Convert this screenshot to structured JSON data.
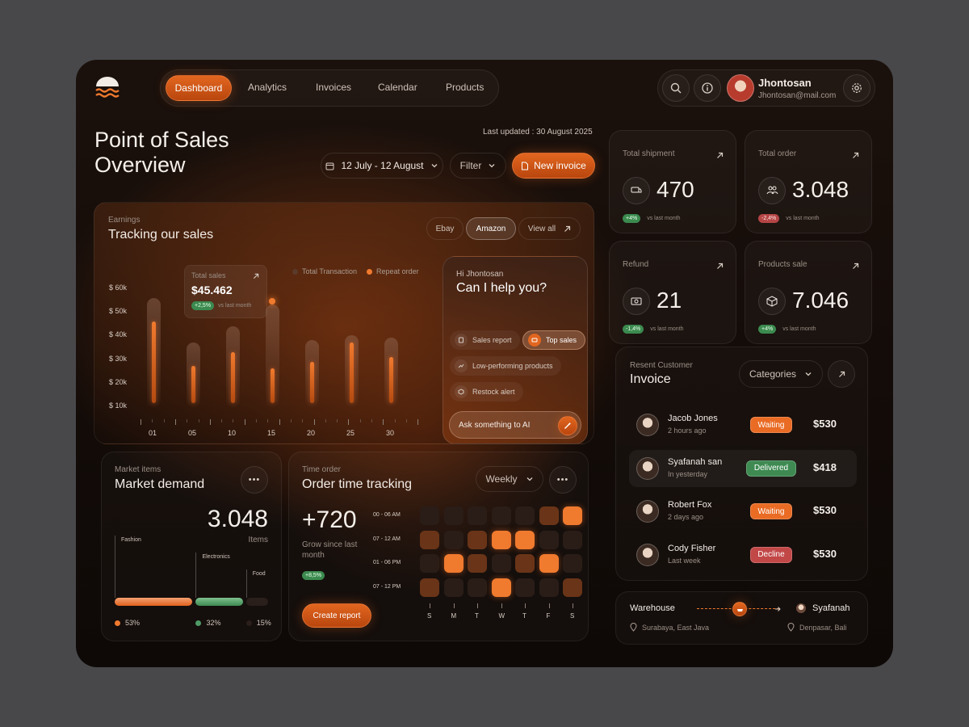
{
  "nav": {
    "tabs": [
      {
        "label": "Dashboard"
      },
      {
        "label": "Analytics"
      },
      {
        "label": "Invoices"
      },
      {
        "label": "Calendar"
      },
      {
        "label": "Products"
      }
    ]
  },
  "user": {
    "name": "Jhontosan",
    "email": "Jhontosan@mail.com"
  },
  "header": {
    "title_line1": "Point of Sales",
    "title_line2": "Overview",
    "last_updated": "Last updated : 30 August 2025",
    "date_range": "12 July - 12 August",
    "filter_label": "Filter",
    "new_invoice_label": "New invoice"
  },
  "earnings": {
    "eyebrow": "Earnings",
    "title": "Tracking our sales",
    "tabs": [
      {
        "label": "Ebay"
      },
      {
        "label": "Amazon"
      },
      {
        "label": "View all"
      }
    ],
    "total_sales_label": "Total sales",
    "total_sales_value": "$45.462",
    "total_sales_change": "+2,5%",
    "vs_last_month": "vs last month",
    "legend": [
      {
        "label": "Total Transaction",
        "color": "#5a3a2a"
      },
      {
        "label": "Repeat order",
        "color": "#f07a2e"
      }
    ]
  },
  "chart_data": {
    "type": "bar",
    "y_tick_labels": [
      "$ 60k",
      "$ 50k",
      "$ 40k",
      "$ 30k",
      "$ 20k",
      "$ 10k"
    ],
    "x_tick_labels": [
      "01",
      "05",
      "10",
      "15",
      "20",
      "25",
      "30"
    ],
    "ylim": [
      10,
      60
    ],
    "series": [
      {
        "name": "Total Transaction",
        "values": [
          56,
          37,
          44,
          53,
          38,
          40,
          39
        ]
      },
      {
        "name": "Repeat order",
        "values": [
          46,
          27,
          33,
          26,
          29,
          37,
          31
        ]
      }
    ],
    "highlight_index": 3,
    "grid": false,
    "legend_position": "top-right"
  },
  "ai": {
    "greeting": "Hi Jhontosan",
    "prompt": "Can I help you?",
    "chips": [
      {
        "label": "Sales report",
        "icon": "document-icon"
      },
      {
        "label": "Top sales",
        "icon": "receipt-icon"
      },
      {
        "label": "Low-performing products",
        "icon": "trend-icon"
      },
      {
        "label": "Restock alert",
        "icon": "box-icon"
      }
    ],
    "ask_placeholder": "Ask something to AI"
  },
  "market": {
    "eyebrow": "Market items",
    "title": "Market demand",
    "value": "3.048",
    "unit": "Items",
    "categories": [
      {
        "label": "Fashion",
        "percent": "53%",
        "share": 0.53,
        "color": "#f07a2e"
      },
      {
        "label": "Electronics",
        "percent": "32%",
        "share": 0.32,
        "color": "#4f9a66"
      },
      {
        "label": "Food",
        "percent": "15%",
        "share": 0.15,
        "color": "#2a1f1a"
      }
    ]
  },
  "order_time": {
    "eyebrow": "Time order",
    "title": "Order time tracking",
    "period": "Weekly",
    "value": "+720",
    "subtitle": "Grow since last month",
    "change": "+8,5%",
    "button_label": "Create report",
    "rows": [
      "00 - 06 AM",
      "07 - 12 AM",
      "01 - 06 PM",
      "07 - 12 PM"
    ],
    "days": [
      "S",
      "M",
      "T",
      "W",
      "T",
      "F",
      "S"
    ],
    "levels": [
      [
        1,
        1,
        1,
        1,
        1,
        2,
        3
      ],
      [
        2,
        1,
        2,
        3,
        3,
        1,
        1
      ],
      [
        1,
        3,
        2,
        1,
        2,
        3,
        1
      ],
      [
        2,
        1,
        1,
        3,
        1,
        1,
        2
      ]
    ]
  },
  "stats": [
    {
      "label": "Total shipment",
      "value": "470",
      "change": "+4%",
      "positive": true,
      "icon": "truck-icon"
    },
    {
      "label": "Total order",
      "value": "3.048",
      "change": "-2,4%",
      "positive": false,
      "icon": "users-icon"
    },
    {
      "label": "Refund",
      "value": "21",
      "change": "-1,4%",
      "positive": true,
      "icon": "money-icon"
    },
    {
      "label": "Products sale",
      "value": "7.046",
      "change": "+4%",
      "positive": true,
      "icon": "cube-icon"
    }
  ],
  "stats_vs": "vs last month",
  "invoice": {
    "eyebrow": "Resent Customer",
    "title": "Invoice",
    "filter_label": "Categories",
    "rows": [
      {
        "name": "Jacob Jones",
        "time": "2 hours ago",
        "status": "Waiting",
        "amount": "$530",
        "status_color": "#e96b24"
      },
      {
        "name": "Syafanah san",
        "time": "In yesterday",
        "status": "Delivered",
        "amount": "$418",
        "status_color": "#3e8a52"
      },
      {
        "name": "Robert Fox",
        "time": "2 days ago",
        "status": "Waiting",
        "amount": "$530",
        "status_color": "#e96b24"
      },
      {
        "name": "Cody Fisher",
        "time": "Last week",
        "status": "Decline",
        "amount": "$530",
        "status_color": "#c24747"
      }
    ]
  },
  "shipping": {
    "from_label": "Warehouse",
    "from_location": "Surabaya, East Java",
    "to_label": "Syafanah",
    "to_location": "Denpasar, Bali"
  }
}
